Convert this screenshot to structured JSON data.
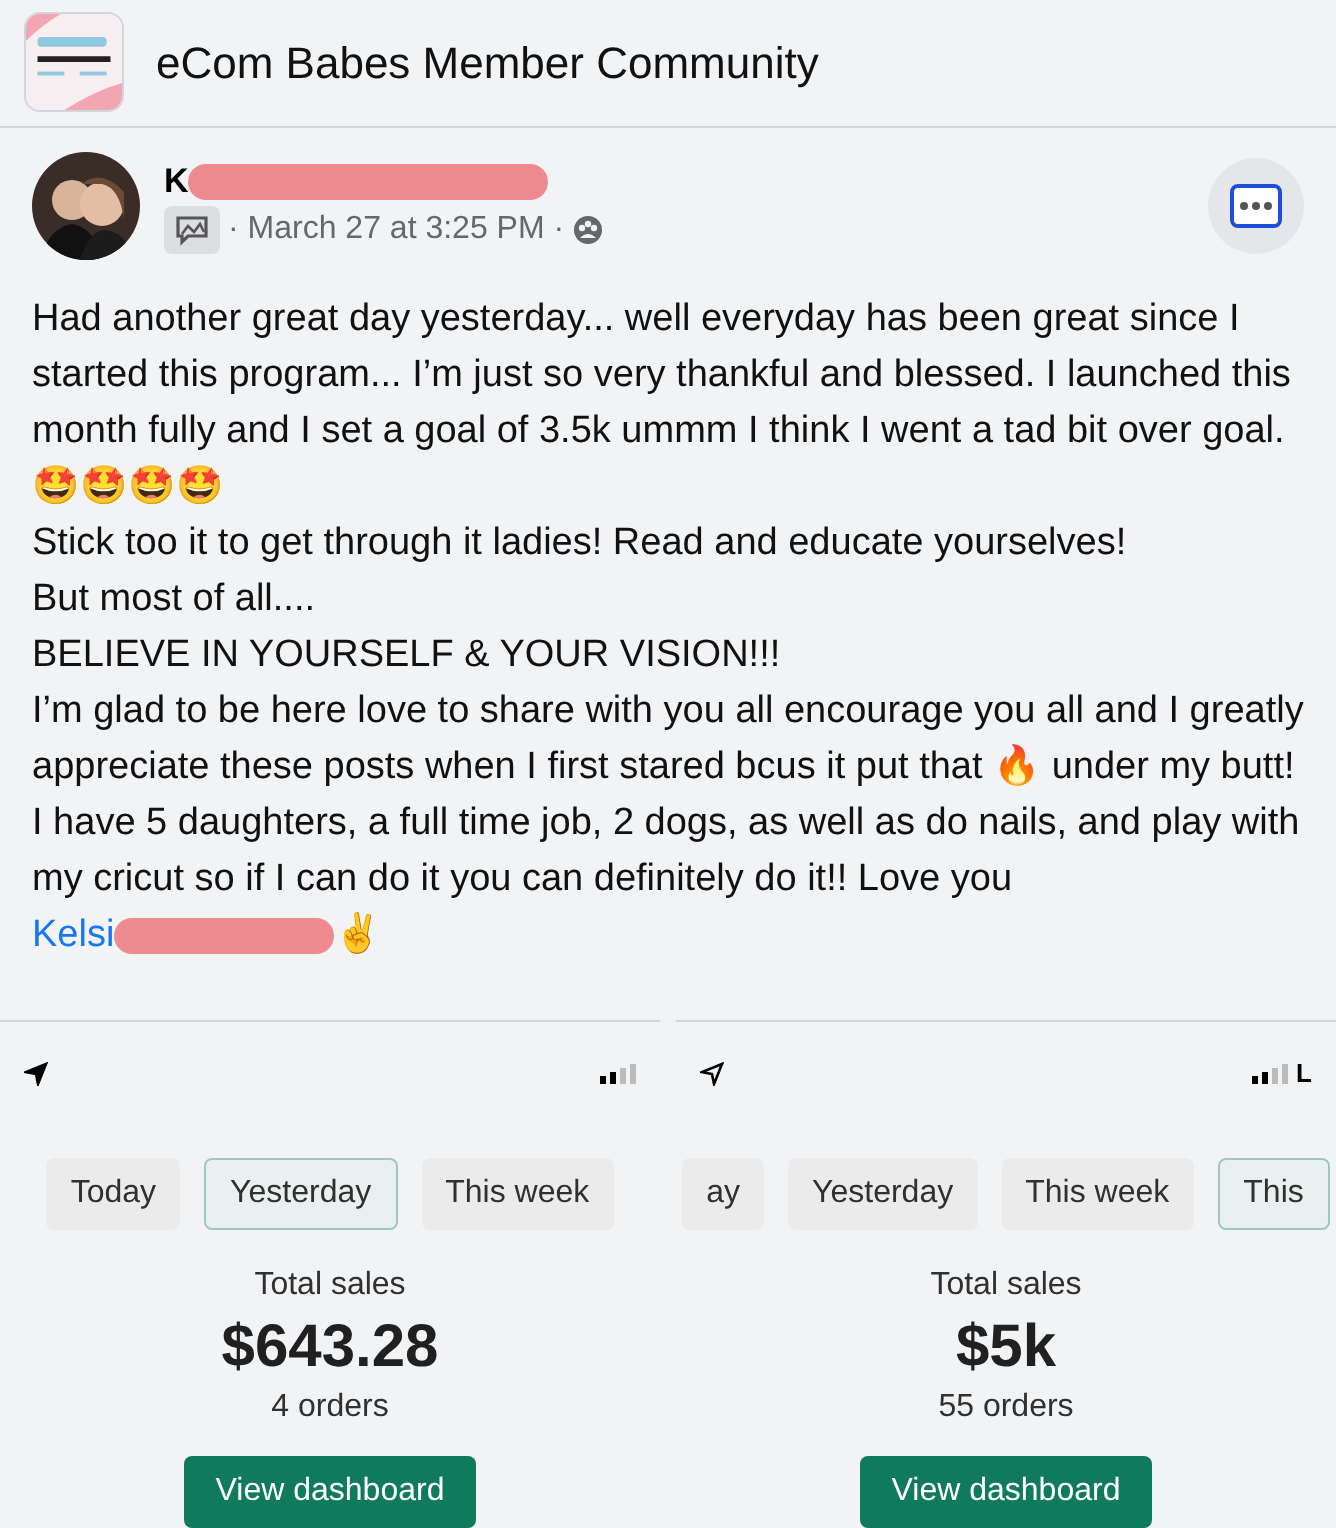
{
  "group": {
    "name": "eCom Babes Member Community"
  },
  "post": {
    "author": "K",
    "meta": "· March 27 at 3:25 PM ·",
    "paragraphs": [
      "Had another great day yesterday... well everyday has been great since I started this program... I’m just so very thankful and blessed. I launched this month fully and I set a goal of 3.5k ummm I think I went a tad bit over goal. 🤩🤩🤩🤩",
      "Stick too it to get through it ladies! Read and educate yourselves!",
      "But most of all....",
      "BELIEVE IN YOURSELF & YOUR VISION!!!",
      "I’m glad to be here love to share with you all encourage you all and I greatly appreciate these posts when I first stared bcus it put that 🔥 under my butt!",
      "I have 5 daughters, a full time job, 2 dogs, as well as do nails, and play with my cricut so if I can do it you can definitely do it!! Love you"
    ],
    "tag": "Kelsi",
    "tag_suffix": "✌"
  },
  "screenshots": [
    {
      "tabs": [
        {
          "label": "Today",
          "selected": false
        },
        {
          "label": "Yesterday",
          "selected": true
        },
        {
          "label": "This week",
          "selected": false
        }
      ],
      "total_label": "Total sales",
      "amount": "$643.28",
      "orders": "4 orders",
      "button": "View dashboard"
    },
    {
      "status_text": "L",
      "tabs": [
        {
          "label": "ay",
          "selected": false
        },
        {
          "label": "Yesterday",
          "selected": false
        },
        {
          "label": "This week",
          "selected": false
        },
        {
          "label": "This",
          "selected": true
        }
      ],
      "total_label": "Total sales",
      "amount": "$5k",
      "orders": "55 orders",
      "button": "View dashboard"
    }
  ]
}
